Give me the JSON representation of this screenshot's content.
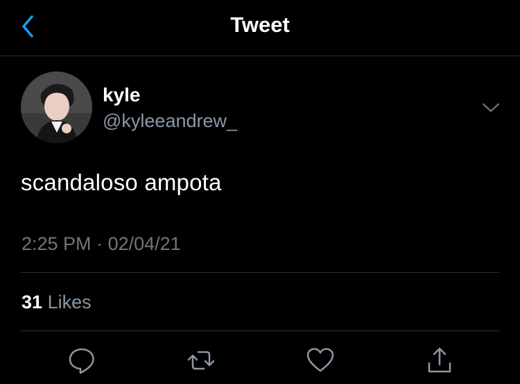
{
  "header": {
    "title": "Tweet",
    "back_icon": "chevron-left-icon",
    "accent_color": "#1d9bf0"
  },
  "tweet": {
    "author": {
      "name": "kyle",
      "handle": "@kyleeandrew_"
    },
    "more_icon": "chevron-down-icon",
    "text": "scandaloso ampota",
    "time": "2:25 PM",
    "separator": "·",
    "date": "02/04/21",
    "likes": {
      "count": "31",
      "label": "Likes"
    }
  },
  "actions": [
    {
      "name": "reply",
      "icon": "reply-icon"
    },
    {
      "name": "retweet",
      "icon": "retweet-icon"
    },
    {
      "name": "like",
      "icon": "heart-icon"
    },
    {
      "name": "share",
      "icon": "share-icon"
    }
  ],
  "colors": {
    "background": "#000000",
    "secondary_text": "#8b98a5",
    "divider": "#2f3336"
  }
}
